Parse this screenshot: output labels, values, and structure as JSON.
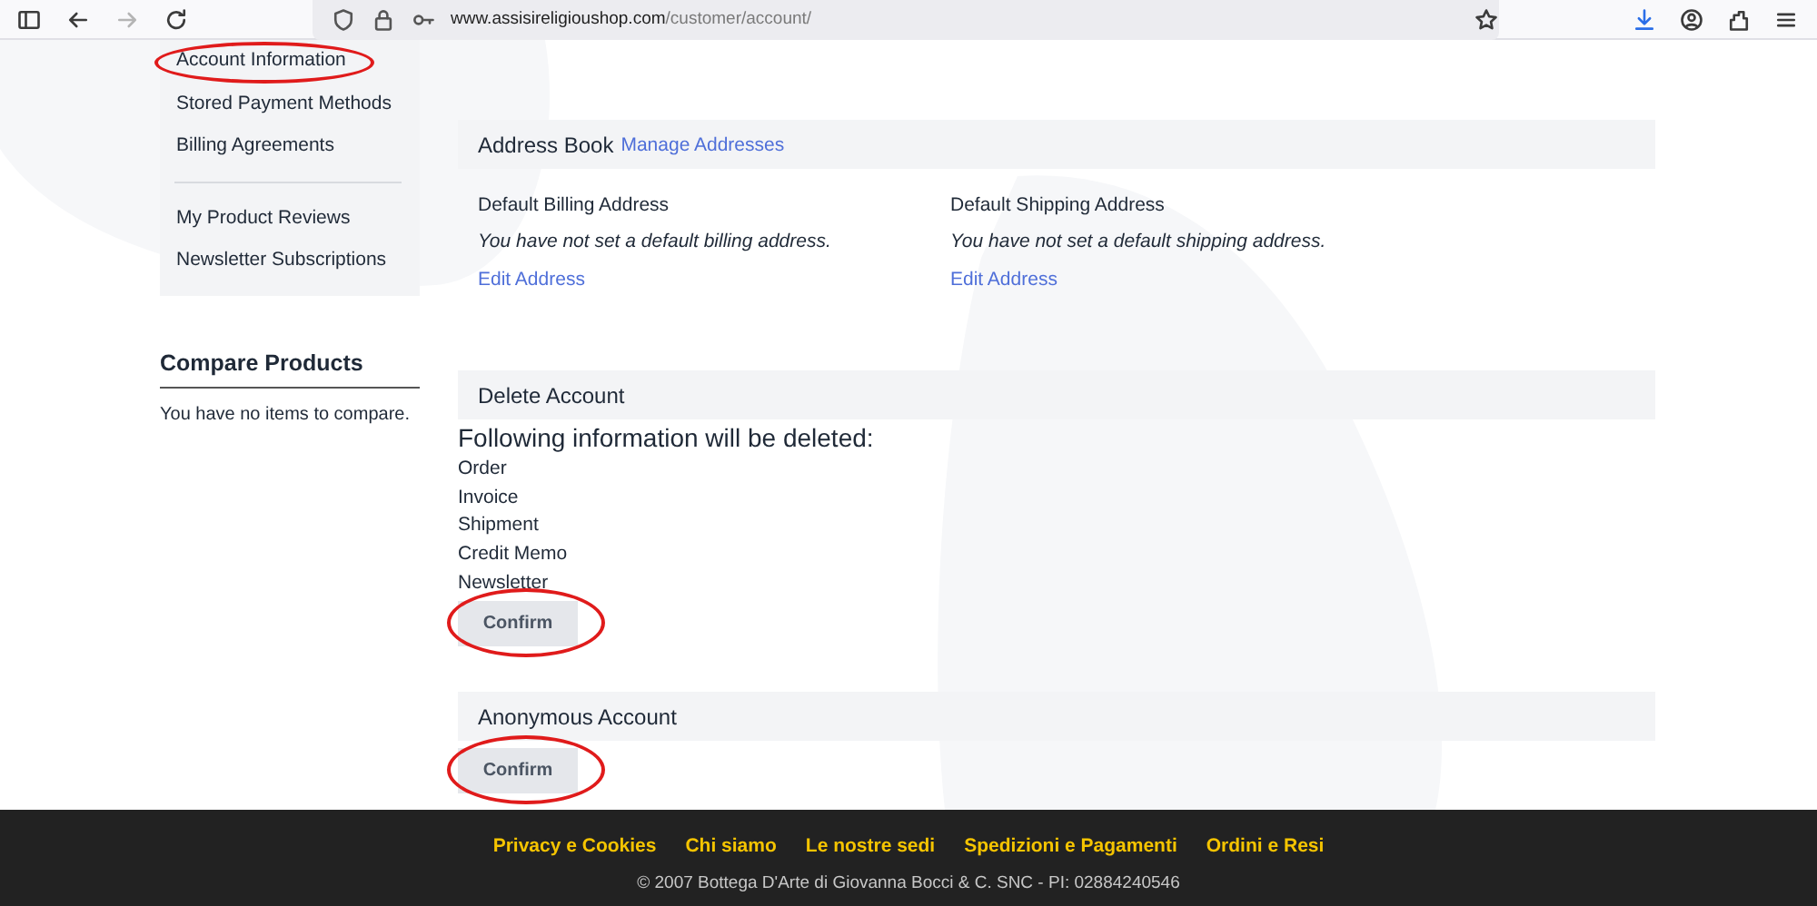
{
  "browser": {
    "url_host": "www.assisireligioushop.com",
    "url_path": "/customer/account/",
    "back_enabled": true,
    "forward_enabled": false
  },
  "sidebar": {
    "groups": [
      [
        {
          "label": "Account Information",
          "circled": true
        },
        {
          "label": "Stored Payment Methods",
          "circled": false
        },
        {
          "label": "Billing Agreements",
          "circled": false
        }
      ],
      [
        {
          "label": "My Product Reviews",
          "circled": false
        },
        {
          "label": "Newsletter Subscriptions",
          "circled": false
        }
      ]
    ]
  },
  "compare": {
    "title": "Compare Products",
    "text": "You have no items to compare."
  },
  "address_book": {
    "title": "Address Book",
    "link": "Manage Addresses",
    "columns": [
      {
        "heading": "Default Billing Address",
        "note": "You have not set a default billing address.",
        "link": "Edit Address"
      },
      {
        "heading": "Default Shipping Address",
        "note": "You have not set a default shipping address.",
        "link": "Edit Address"
      }
    ]
  },
  "delete_account": {
    "title": "Delete Account",
    "intro": "Following information will be deleted:",
    "items": [
      "Order",
      "Invoice",
      "Shipment",
      "Credit Memo",
      "Newsletter"
    ],
    "button": {
      "label": "Confirm",
      "circled": true
    }
  },
  "anonymous_account": {
    "title": "Anonymous Account",
    "button": {
      "label": "Confirm",
      "circled": true
    }
  },
  "footer": {
    "links": [
      "Privacy e Cookies",
      "Chi siamo",
      "Le nostre sedi",
      "Spedizioni e Pagamenti",
      "Ordini e Resi"
    ],
    "copyright": "© 2007 Bottega D'Arte di Giovanna Bocci & C. SNC - PI: 02884240546"
  }
}
